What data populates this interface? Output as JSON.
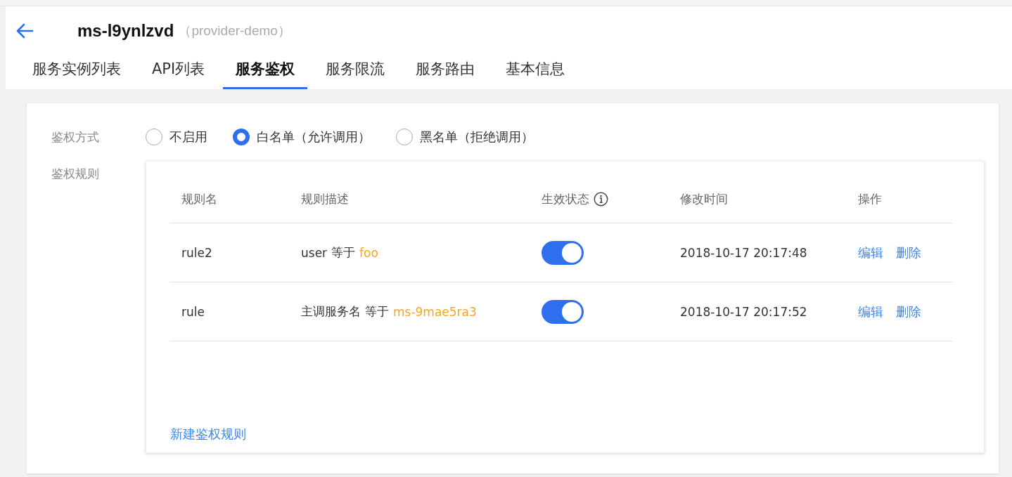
{
  "header": {
    "title": "ms-l9ynlzvd",
    "subtitle": "（provider-demo）"
  },
  "tabs": [
    {
      "label": "服务实例列表",
      "selected": false
    },
    {
      "label": "API列表",
      "selected": false
    },
    {
      "label": "服务鉴权",
      "selected": true
    },
    {
      "label": "服务限流",
      "selected": false
    },
    {
      "label": "服务路由",
      "selected": false
    },
    {
      "label": "基本信息",
      "selected": false
    }
  ],
  "auth_mode": {
    "label": "鉴权方式",
    "options": [
      {
        "label": "不启用",
        "selected": false
      },
      {
        "label": "白名单（允许调用）",
        "selected": true
      },
      {
        "label": "黑名单（拒绝调用）",
        "selected": false
      }
    ]
  },
  "rules": {
    "label": "鉴权规则",
    "columns": [
      "规则名",
      "规则描述",
      "生效状态",
      "修改时间",
      "操作"
    ],
    "rows": [
      {
        "name": "rule2",
        "field": "user",
        "operator": "等于",
        "value": "foo",
        "on": true,
        "modified": "2018-10-17 20:17:48",
        "actions": [
          "编辑",
          "删除"
        ]
      },
      {
        "name": "rule",
        "field": "主调服务名",
        "operator": "等于",
        "value": "ms-9mae5ra3",
        "on": true,
        "modified": "2018-10-17 20:17:52",
        "actions": [
          "编辑",
          "删除"
        ]
      }
    ],
    "add_link": "新建鉴权规则"
  }
}
